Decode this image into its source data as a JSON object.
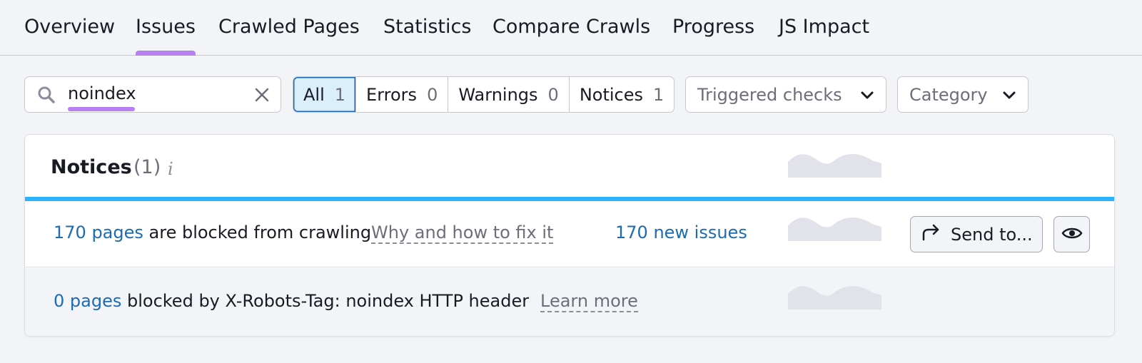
{
  "tabs": [
    {
      "label": "Overview"
    },
    {
      "label": "Issues",
      "active": true
    },
    {
      "label": "Crawled Pages"
    },
    {
      "label": "Statistics"
    },
    {
      "label": "Compare Crawls"
    },
    {
      "label": "Progress"
    },
    {
      "label": "JS Impact"
    }
  ],
  "search": {
    "value": "noindex"
  },
  "filters": {
    "all": {
      "label": "All",
      "count": "1"
    },
    "errors": {
      "label": "Errors",
      "count": "0"
    },
    "warnings": {
      "label": "Warnings",
      "count": "0"
    },
    "notices": {
      "label": "Notices",
      "count": "1"
    }
  },
  "dropdowns": {
    "triggered": "Triggered checks",
    "category": "Category"
  },
  "card": {
    "title": "Notices",
    "count": "(1)",
    "rows": [
      {
        "link": "170 pages",
        "text": "are blocked from crawling",
        "help": "Why and how to fix it",
        "new_issues": "170 new issues",
        "send_label": "Send to..."
      },
      {
        "link": "0 pages",
        "text": "blocked by X-Robots-Tag: noindex HTTP header",
        "help": "Learn more"
      }
    ]
  },
  "colors": {
    "accent_underline": "#b77ff2",
    "link": "#1d6bb2",
    "bar": "#2bb3ff"
  }
}
